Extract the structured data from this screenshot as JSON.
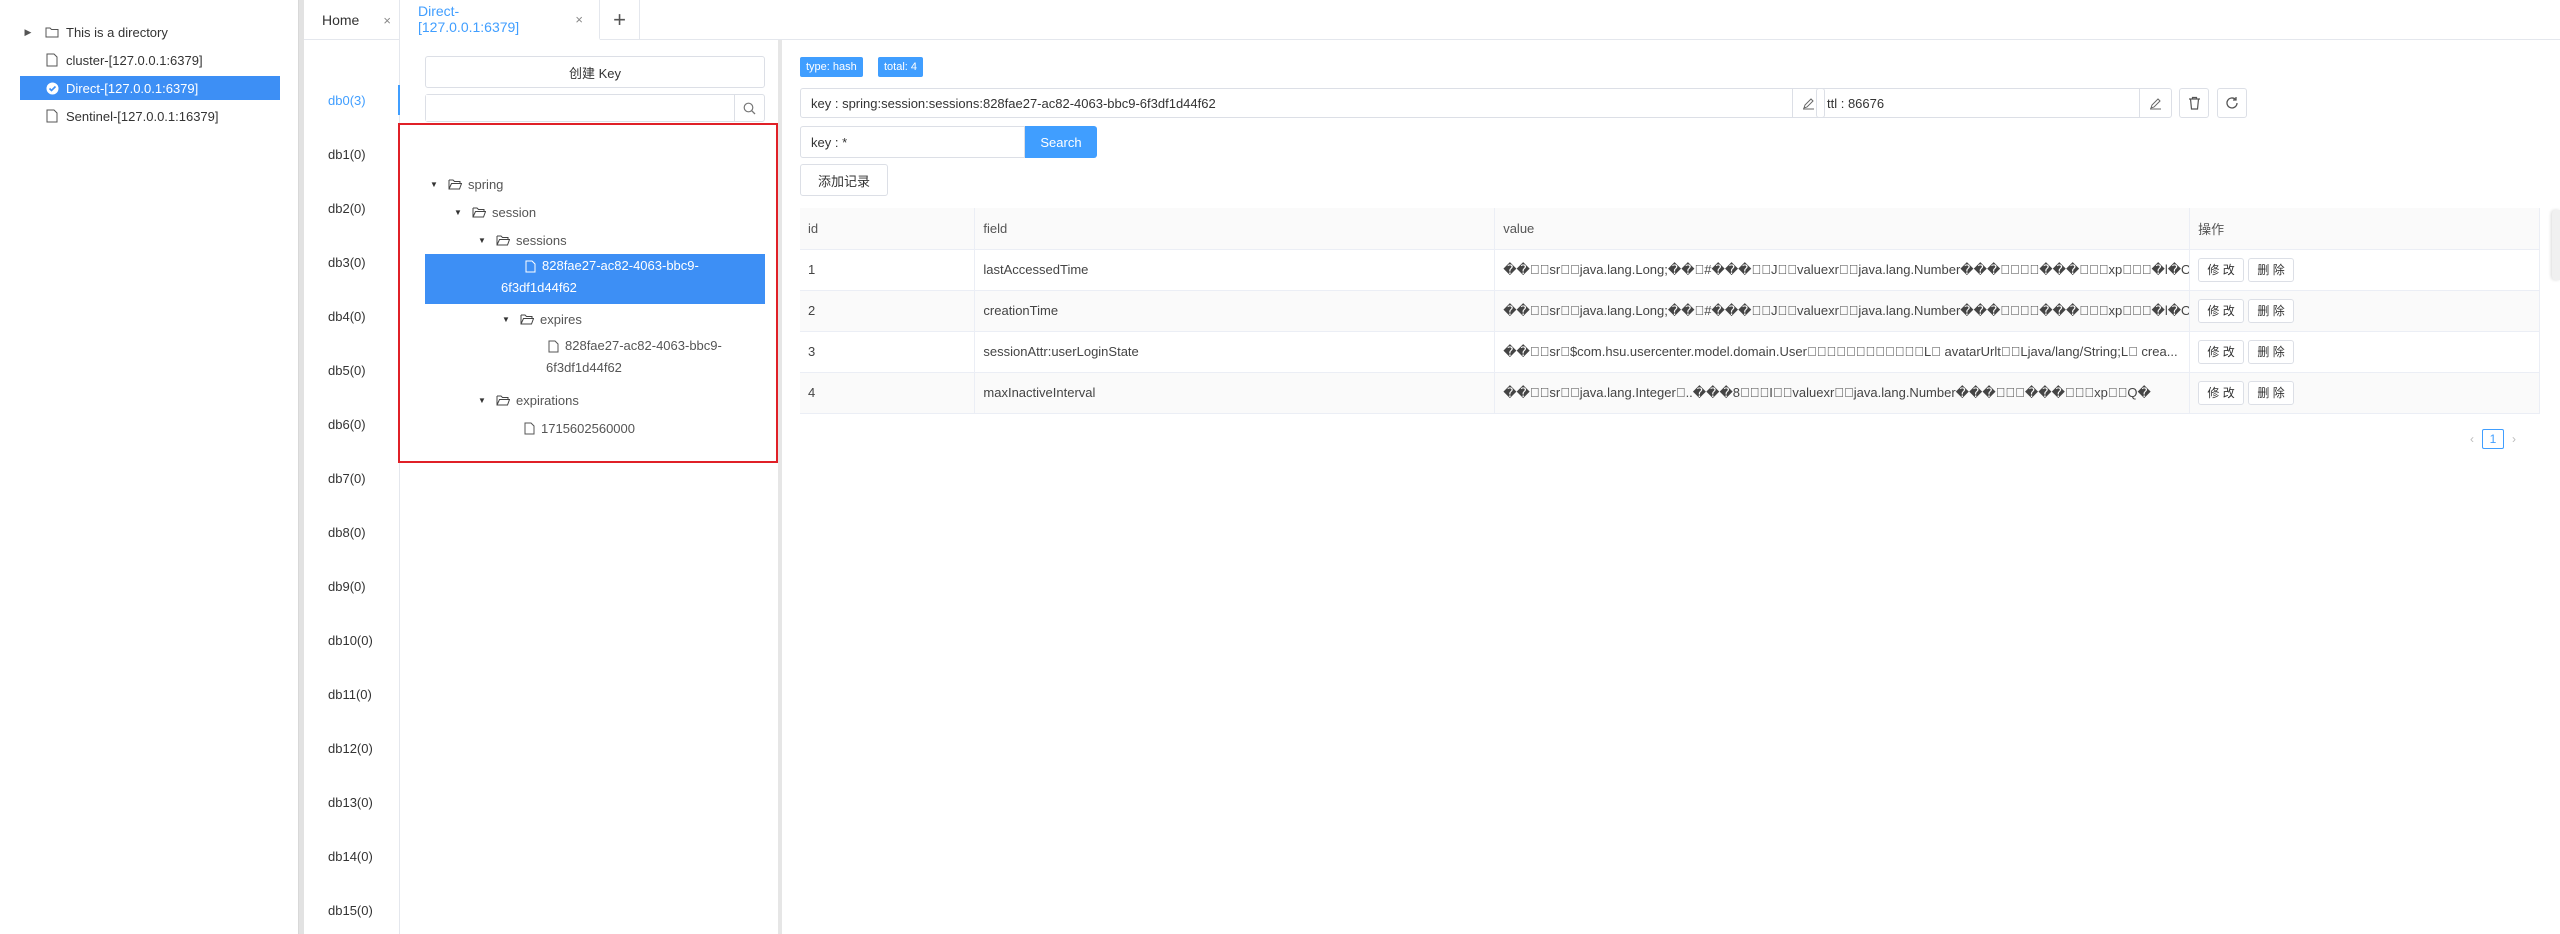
{
  "sidebar": {
    "items": [
      {
        "label": "This is a directory",
        "icon": "folder-icon",
        "expandable": true
      },
      {
        "label": "cluster-[127.0.0.1:6379]",
        "icon": "file-icon"
      },
      {
        "label": "Direct-[127.0.0.1:6379]",
        "icon": "check-circle-icon",
        "active": true
      },
      {
        "label": "Sentinel-[127.0.0.1:16379]",
        "icon": "file-icon"
      }
    ]
  },
  "tabs": [
    {
      "label": "Home",
      "close": "×"
    },
    {
      "label": "Direct-[127.0.0.1:6379]",
      "close": "×",
      "active": true
    }
  ],
  "add_tab": "+",
  "databases": [
    "db0(3)",
    "db1(0)",
    "db2(0)",
    "db3(0)",
    "db4(0)",
    "db5(0)",
    "db6(0)",
    "db7(0)",
    "db8(0)",
    "db9(0)",
    "db10(0)",
    "db11(0)",
    "db12(0)",
    "db13(0)",
    "db14(0)",
    "db15(0)"
  ],
  "key_panel": {
    "create_label": "创建 Key",
    "search_value": "",
    "tree": {
      "spring": "spring",
      "session": "session",
      "sessions": "sessions",
      "selected_key_line1": "828fae27-ac82-4063-bbc9-",
      "selected_key_line2": "6f3df1d44f62",
      "expires": "expires",
      "expires_key_line1": "828fae27-ac82-4063-bbc9-",
      "expires_key_line2": "6f3df1d44f62",
      "expirations": "expirations",
      "expirations_key": "1715602560000"
    }
  },
  "detail": {
    "type_badge": "type: hash",
    "total_badge": "total: 4",
    "key_value": "key : spring:session:sessions:828fae27-ac82-4063-bbc9-6f3df1d44f62",
    "ttl_value": "ttl : 86676",
    "filter_value": "key : *",
    "search_label": "Search",
    "add_record_label": "添加记录",
    "columns": [
      "id",
      "field",
      "value",
      "操作"
    ],
    "rows": [
      {
        "id": "1",
        "field": "lastAccessedTime",
        "value": "��\u0000\u0005sr\u0000\u000ejava.lang.Long;��\u001a#���\u0000\u0001J\u0000\u0005valuexr\u0000\u0010java.lang.Number���\u0000\u0000\u0000\u0000���\u0000\u0000\u0000xp\u0000\u0000\u0000�l�O�"
      },
      {
        "id": "2",
        "field": "creationTime",
        "value": "��\u0000\u0005sr\u0000\u000ejava.lang.Long;��\u001a#���\u0000\u0001J\u0000\u0005valuexr\u0000\u0010java.lang.Number���\u0000\u0000\u0000\u0000���\u0000\u0000\u0000xp\u0000\u0000\u0000�l�O�"
      },
      {
        "id": "3",
        "field": "sessionAttr:userLoginState",
        "value": "��\u0000\u0005sr\u0000$com.hsu.usercenter.model.domain.User\u0000\u0000\u0000\u0000\u0000\u0000\u0000\u0000\u0000\u0000\u0000\u0001L\u0000 avatarUrlt\u0000\u0012Ljava/lang/String;L\u0000 crea..."
      },
      {
        "id": "4",
        "field": "maxInactiveInterval",
        "value": "��\u0000\u0005sr\u0000\u0011java.lang.Integer\u0000..���8\u0000\u0000\u0000I\u0000\u0005valuexr\u0000\u0010java.lang.Number���\u0000\u0000\u0000���\u0000\u0000\u0000xp\u0000\u0000Q�"
      }
    ],
    "modify_label": "修 改",
    "delete_label": "删 除",
    "pager": {
      "prev": "‹",
      "current": "1",
      "next": "›"
    }
  }
}
